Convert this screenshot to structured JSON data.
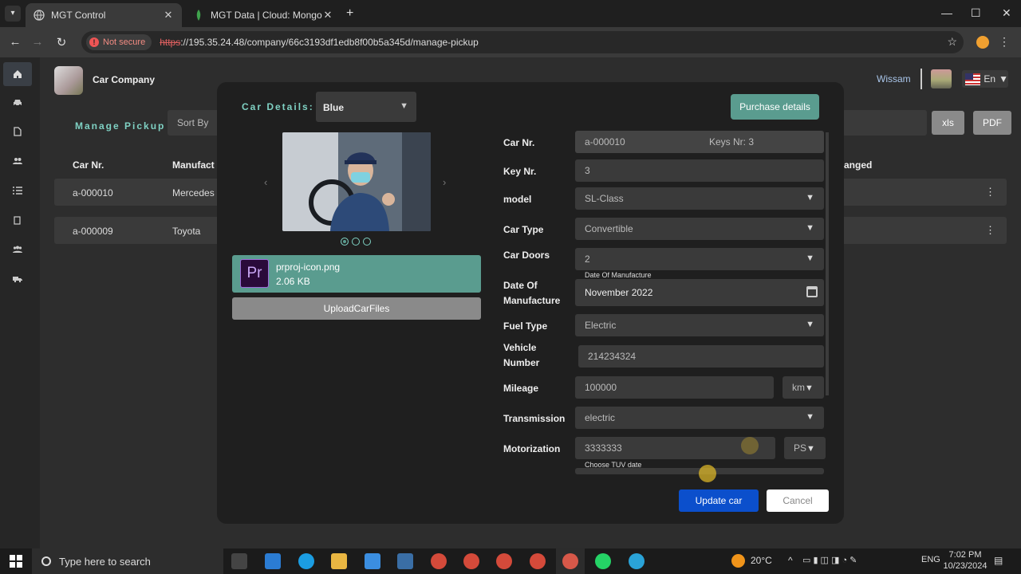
{
  "browser": {
    "tabs": [
      {
        "title": "MGT Control",
        "active": true
      },
      {
        "title": "MGT Data | Cloud: MongoDB Cl",
        "active": false
      }
    ],
    "security_label": "Not secure",
    "url_scheme": "https",
    "url_rest": "://195.35.24.48/company/66c3193df1edb8f00b5a345d/manage-pickup"
  },
  "app": {
    "brand_name": "Car Company",
    "user_name": "Wissam",
    "language": "En",
    "page_title": "Manage Pickup",
    "sort_placeholder": "Sort By",
    "export_buttons": [
      "xls",
      "PDF"
    ],
    "columns": [
      "Car Nr.",
      "Manufact",
      "anged"
    ],
    "rows": [
      {
        "car_nr": "a-000010",
        "manufacturer": "Mercedes"
      },
      {
        "car_nr": "a-000009",
        "manufacturer": "Toyota"
      }
    ],
    "sidebar_icons": [
      "home-icon",
      "car-icon",
      "document-icon",
      "users-icon",
      "list-icon",
      "copy-icon",
      "team-icon",
      "truck-icon"
    ]
  },
  "modal": {
    "title": "Car Details:",
    "color_value": "Blue",
    "purchase_button": "Purchase details",
    "carousel": {
      "total": 3,
      "active": 1
    },
    "file": {
      "name": "prproj-icon.png",
      "size": "2.06 KB",
      "icon_text": "Pr"
    },
    "upload_button": "UploadCarFiles",
    "fields": {
      "car_nr": {
        "label": "Car Nr.",
        "value": "a-000010",
        "keys_text": "Keys Nr: 3"
      },
      "key_nr": {
        "label": "Key Nr.",
        "value": "3"
      },
      "model": {
        "label": "model",
        "value": "SL-Class"
      },
      "car_type": {
        "label": "Car Type",
        "value": "Convertible"
      },
      "car_doors": {
        "label": "Car Doors",
        "value": "2"
      },
      "date_of_manufacture": {
        "label_line1": "Date Of",
        "label_line2": "Manufacture",
        "float_label": "Date Of Manufacture",
        "value": "November 2022"
      },
      "fuel_type": {
        "label": "Fuel Type",
        "value": "Electric"
      },
      "vehicle_number": {
        "label_line1": "Vehicle",
        "label_line2": "Number",
        "value": "214234324"
      },
      "mileage": {
        "label": "Mileage",
        "value": "100000",
        "unit": "km"
      },
      "transmission": {
        "label": "Transmission",
        "value": "electric"
      },
      "motorization": {
        "label": "Motorization",
        "value": "3333333",
        "unit": "PS"
      },
      "tuv_date": {
        "float_label": "Choose TUV date"
      }
    },
    "update_button": "Update car",
    "cancel_button": "Cancel"
  },
  "taskbar": {
    "search_placeholder": "Type here to search",
    "temperature": "20°C",
    "language": "ENG",
    "time": "7:02 PM",
    "date": "10/23/2024"
  },
  "colors": {
    "accent_teal": "#7fd1c3",
    "file_card": "#5a9c8f",
    "primary_blue": "#0b4fcc",
    "modal_bg": "#1f1f1f",
    "field_bg": "#3a3a3a"
  }
}
